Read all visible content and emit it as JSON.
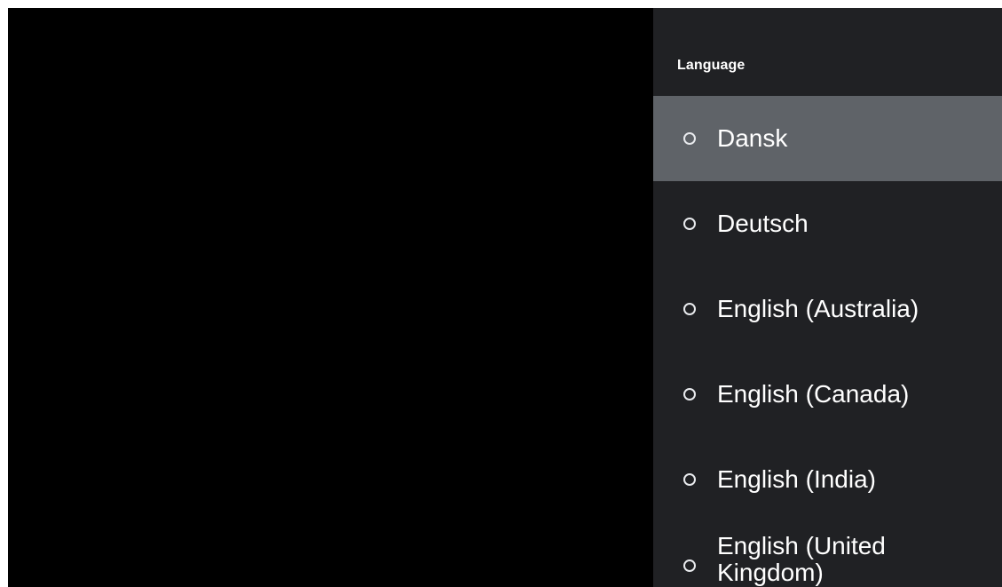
{
  "panel": {
    "title": "Language",
    "items": [
      {
        "label": "Dansk",
        "selected": false,
        "focused": true
      },
      {
        "label": "Deutsch",
        "selected": false,
        "focused": false
      },
      {
        "label": "English (Australia)",
        "selected": false,
        "focused": false
      },
      {
        "label": "English (Canada)",
        "selected": false,
        "focused": false
      },
      {
        "label": "English (India)",
        "selected": false,
        "focused": false
      },
      {
        "label": "English (United Kingdom)",
        "selected": false,
        "focused": false
      }
    ]
  },
  "colors": {
    "background": "#000000",
    "panel": "#202124",
    "focus_highlight": "#5f6368",
    "text": "#ffffff"
  }
}
